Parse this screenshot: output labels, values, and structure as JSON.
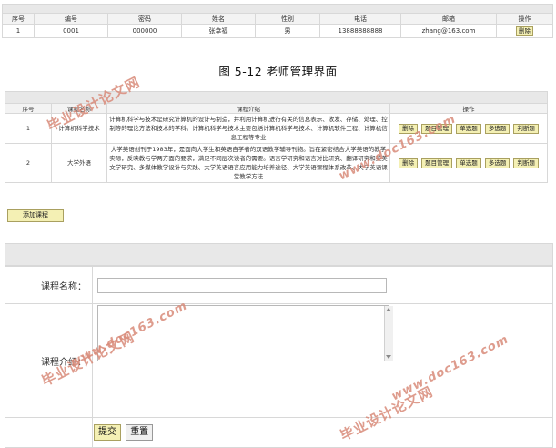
{
  "teacher_table": {
    "headers": [
      "序号",
      "编号",
      "密码",
      "姓名",
      "性别",
      "电话",
      "邮箱",
      "操作"
    ],
    "rows": [
      {
        "seq": "1",
        "code": "0001",
        "password": "000000",
        "name": "张幸福",
        "gender": "男",
        "phone": "13888888888",
        "email": "zhang@163.com",
        "action": "删除"
      }
    ]
  },
  "caption": "图 5-12 老师管理界面",
  "course_table": {
    "headers": [
      "序号",
      "课程名称",
      "课程介绍",
      "操作"
    ],
    "rows": [
      {
        "seq": "1",
        "name": "计算机科学技术",
        "intro": "计算机科学与技术是研究计算机的设计与制造，并利用计算机进行有关的信息表示、收发、存储、处理、控制等的理论方法和技术的学科。计算机科学与技术主要包括计算机科学与技术、计算机软件工程、计算机信息工程等专业",
        "actions": [
          "删除",
          "题目管理",
          "单选题",
          "多选题",
          "判断题"
        ]
      },
      {
        "seq": "2",
        "name": "大学外语",
        "intro": "大学英语创刊于1983年，是面向大学生和英语自学者的双语教学辅导刊物。旨在紧密结合大学英语的教学实际，反映教与学两方面的要求，满足不同层次读者的需要。语言学研究和语言对比研究、翻译研究和英美文学研究、多媒体教学设计与实践、大学英语语言应用能力培养途径、大学英语课程体系改革、大学英语课堂教学方法",
        "actions": [
          "删除",
          "题目管理",
          "单选题",
          "多选题",
          "判断题"
        ]
      }
    ],
    "add_label": "添加课程"
  },
  "form": {
    "name_label": "课程名称：",
    "name_value": "",
    "intro_label": "课程介绍：",
    "intro_value": "",
    "submit_label": "提交",
    "reset_label": "重置"
  },
  "watermarks": {
    "cn": "毕业设计论文网",
    "url": "www.doc163.com"
  }
}
